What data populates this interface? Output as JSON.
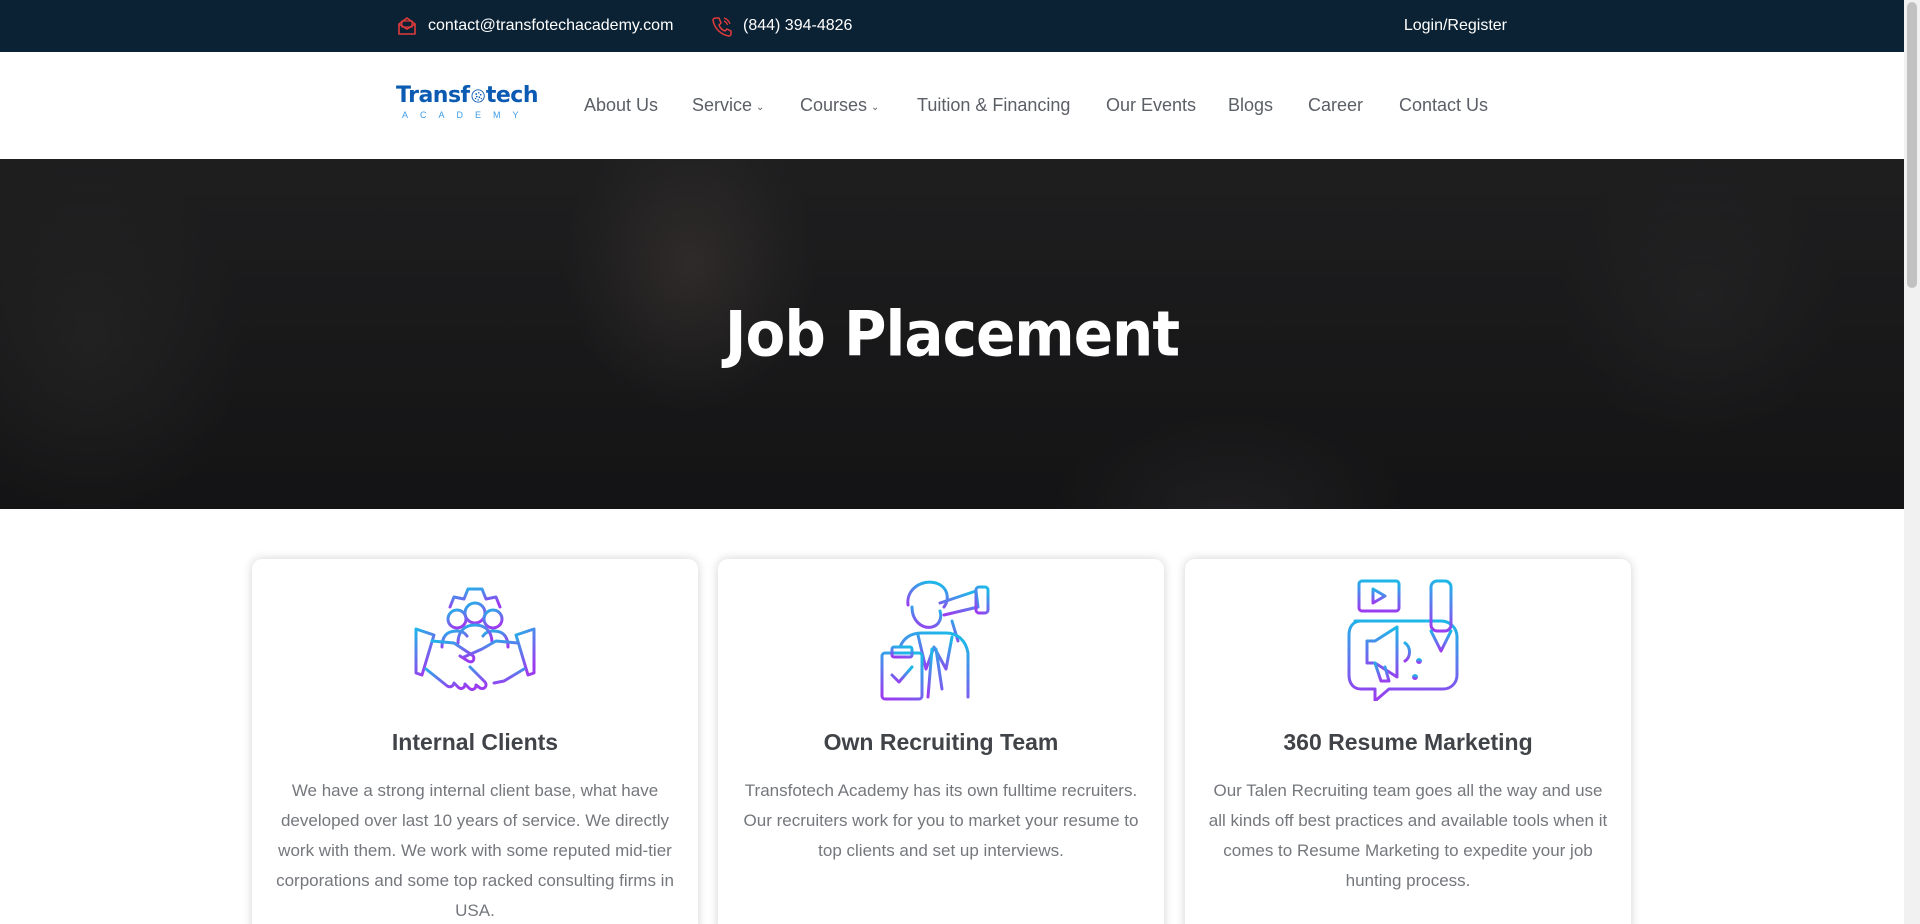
{
  "topbar": {
    "email": "contact@transfotechacademy.com",
    "phone": "(844) 394-4826",
    "login": "Login/Register"
  },
  "logo": {
    "part1": "Transf",
    "part2": "tech",
    "sub": "ACADEMY"
  },
  "nav": {
    "items": [
      {
        "label": "About Us"
      },
      {
        "label": "Service"
      },
      {
        "label": "Courses"
      },
      {
        "label": "Tuition & Financing"
      },
      {
        "label": "Our Events"
      },
      {
        "label": "Blogs"
      },
      {
        "label": "Career"
      },
      {
        "label": "Contact Us"
      }
    ]
  },
  "hero": {
    "title": "Job Placement"
  },
  "cards": [
    {
      "icon": "handshake-team-icon",
      "title": "Internal Clients",
      "text": "We have a strong internal client base, what have developed over last 10 years of service. We directly work with them. We work with some reputed mid-tier corporations and some top racked consulting firms in USA."
    },
    {
      "icon": "recruiter-telescope-icon",
      "title": "Own Recruiting Team",
      "text": "Transfotech Academy has its own fulltime recruiters. Our recruiters work for you to market your resume to top clients and set up interviews."
    },
    {
      "icon": "marketing-megaphone-icon",
      "title": "360 Resume Marketing",
      "text": "Our Talen Recruiting team goes all the way and use all kinds off best practices and available tools when it comes to Resume Marketing to expedite your job hunting process."
    }
  ],
  "colors": {
    "topbar_bg": "#0b2234",
    "brand_blue": "#0c5bb3",
    "icon_gradient_start": "#1fb6e8",
    "icon_gradient_end": "#9b3cf0",
    "text_gray": "#74777c"
  }
}
